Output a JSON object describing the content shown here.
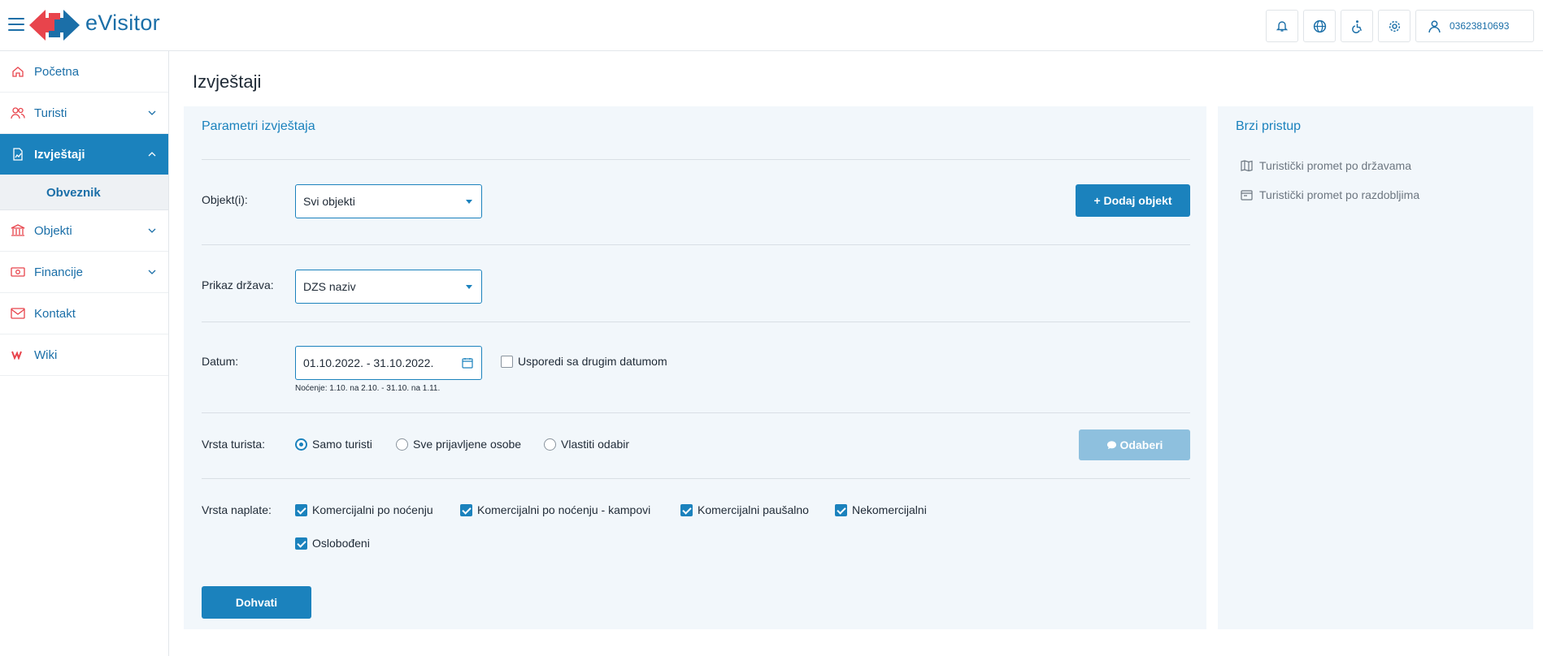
{
  "header": {
    "brand": "eVisitor",
    "user_id": "03623810693",
    "icons": [
      "bell-icon",
      "globe-icon",
      "accessibility-icon",
      "gear-icon",
      "user-icon"
    ]
  },
  "sidebar": {
    "items": [
      {
        "label": "Početna",
        "icon": "home-icon"
      },
      {
        "label": "Turisti",
        "icon": "users-icon"
      },
      {
        "label": "Izvještaji",
        "icon": "report-icon"
      },
      {
        "label": "Objekti",
        "icon": "building-icon"
      },
      {
        "label": "Financije",
        "icon": "money-icon"
      },
      {
        "label": "Kontakt",
        "icon": "mail-icon"
      },
      {
        "label": "Wiki",
        "icon": "wiki-icon"
      }
    ],
    "sub_item": "Obveznik"
  },
  "main": {
    "title": "Izvještaji",
    "panel_title": "Parametri izvještaja",
    "objects_label": "Objekt(i):",
    "objects_value": "Svi objekti",
    "add_object_button": "+ Dodaj objekt",
    "country_label": "Prikaz država:",
    "country_value": "DZS naziv",
    "date_label": "Datum:",
    "date_value": "01.10.2022. - 31.10.2022.",
    "compare_label": "Usporedi sa drugim datumom",
    "nights_hint": "Noćenje: 1.10. na 2.10. - 31.10. na 1.11.",
    "tourist_type_label": "Vrsta turista:",
    "tourist_type_options": [
      "Samo turisti",
      "Sve prijavljene osobe",
      "Vlastiti odabir"
    ],
    "select_button": "Odaberi",
    "payment_type_label": "Vrsta naplate:",
    "payment_type_options": [
      "Komercijalni po noćenju",
      "Komercijalni po noćenju - kampovi",
      "Komercijalni paušalno",
      "Nekomercijalni",
      "Oslobođeni"
    ],
    "fetch_button": "Dohvati"
  },
  "quick_access": {
    "title": "Brzi pristup",
    "links": [
      "Turistički promet po državama",
      "Turistički promet po razdobljima"
    ]
  },
  "colors": {
    "primary": "#1b82bd",
    "brand_red": "#e8444c",
    "disabled_button": "#8ec0de",
    "panel_bg": "#f2f7fb"
  }
}
